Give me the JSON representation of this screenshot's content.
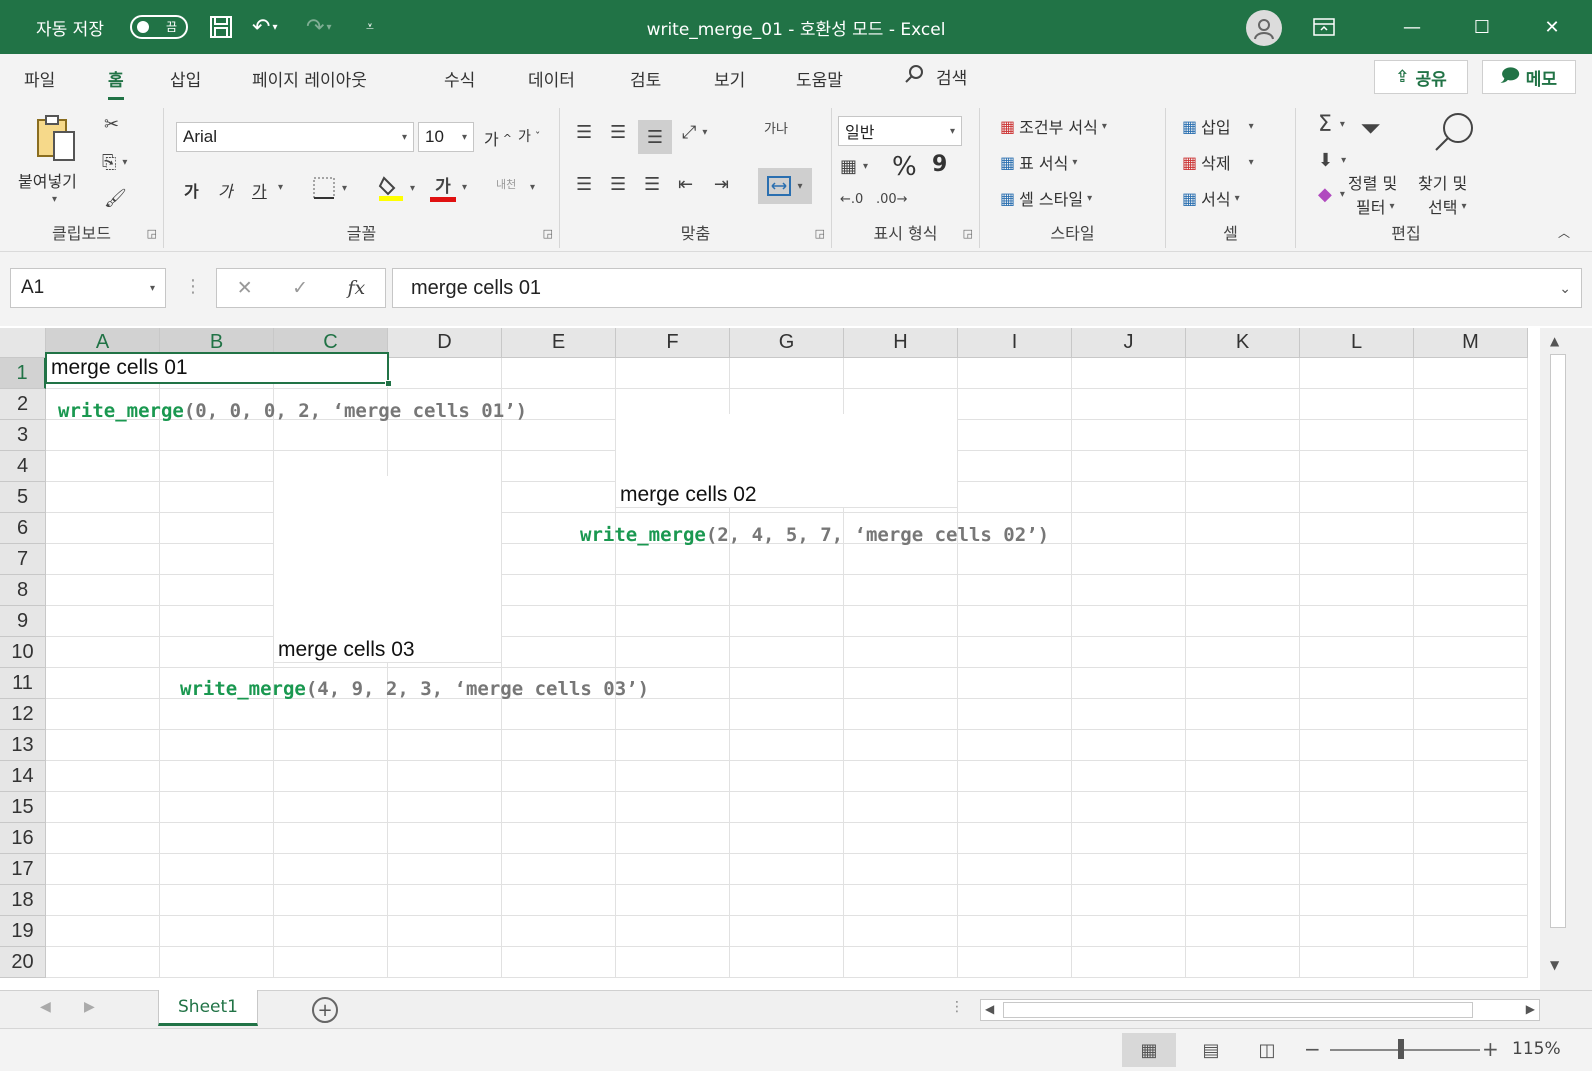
{
  "titlebar": {
    "autosave_label": "자동 저장",
    "autosave_state": "끔",
    "title": "write_merge_01  -  호환성 모드  -  Excel"
  },
  "tabs": [
    "파일",
    "홈",
    "삽입",
    "페이지 레이아웃",
    "수식",
    "데이터",
    "검토",
    "보기",
    "도움말"
  ],
  "active_tab": "홈",
  "search_label": "검색",
  "share_label": "공유",
  "memo_label": "메모",
  "ribbon": {
    "clipboard": {
      "label": "클립보드",
      "paste": "붙여넣기"
    },
    "font": {
      "label": "글꼴",
      "name": "Arial",
      "size": "10",
      "bold": "가",
      "italic": "가",
      "underline": "가",
      "grow": "가",
      "shrink": "가",
      "color": "가",
      "phonetic": "내천"
    },
    "alignment": {
      "label": "맞춤",
      "wrap": "가나"
    },
    "number": {
      "label": "표시 형식",
      "format": "일반",
      "percent": "%",
      "comma": "9"
    },
    "styles": {
      "label": "스타일",
      "conditional": "조건부 서식",
      "table": "표 서식",
      "cell": "셀 스타일"
    },
    "cells": {
      "label": "셀",
      "insert": "삽입",
      "delete": "삭제",
      "format": "서식"
    },
    "editing": {
      "label": "편집",
      "sort": "정렬 및",
      "sort2": "필터",
      "find": "찾기 및",
      "find2": "선택"
    }
  },
  "formula_bar": {
    "name_box": "A1",
    "formula": "merge cells 01",
    "fx": "fx"
  },
  "columns": [
    "A",
    "B",
    "C",
    "D",
    "E",
    "F",
    "G",
    "H",
    "I",
    "J",
    "K",
    "L",
    "M"
  ],
  "rows": [
    "1",
    "2",
    "3",
    "4",
    "5",
    "6",
    "7",
    "8",
    "9",
    "10",
    "11",
    "12",
    "13",
    "14",
    "15",
    "16",
    "17",
    "18",
    "19",
    "20"
  ],
  "merges": [
    {
      "text": "merge cells 01"
    },
    {
      "text": "merge cells 02"
    },
    {
      "text": "merge cells 03"
    }
  ],
  "annotations": [
    {
      "fn": "write_merge",
      "args": "(0, 0, 0, 2, ‘merge cells 01’)"
    },
    {
      "fn": "write_merge",
      "args": "(2, 4, 5, 7, ‘merge cells 02’)"
    },
    {
      "fn": "write_merge",
      "args": "(4, 9, 2, 3, ‘merge cells 03’)"
    }
  ],
  "sheet_tab": "Sheet1",
  "zoom": "115%"
}
